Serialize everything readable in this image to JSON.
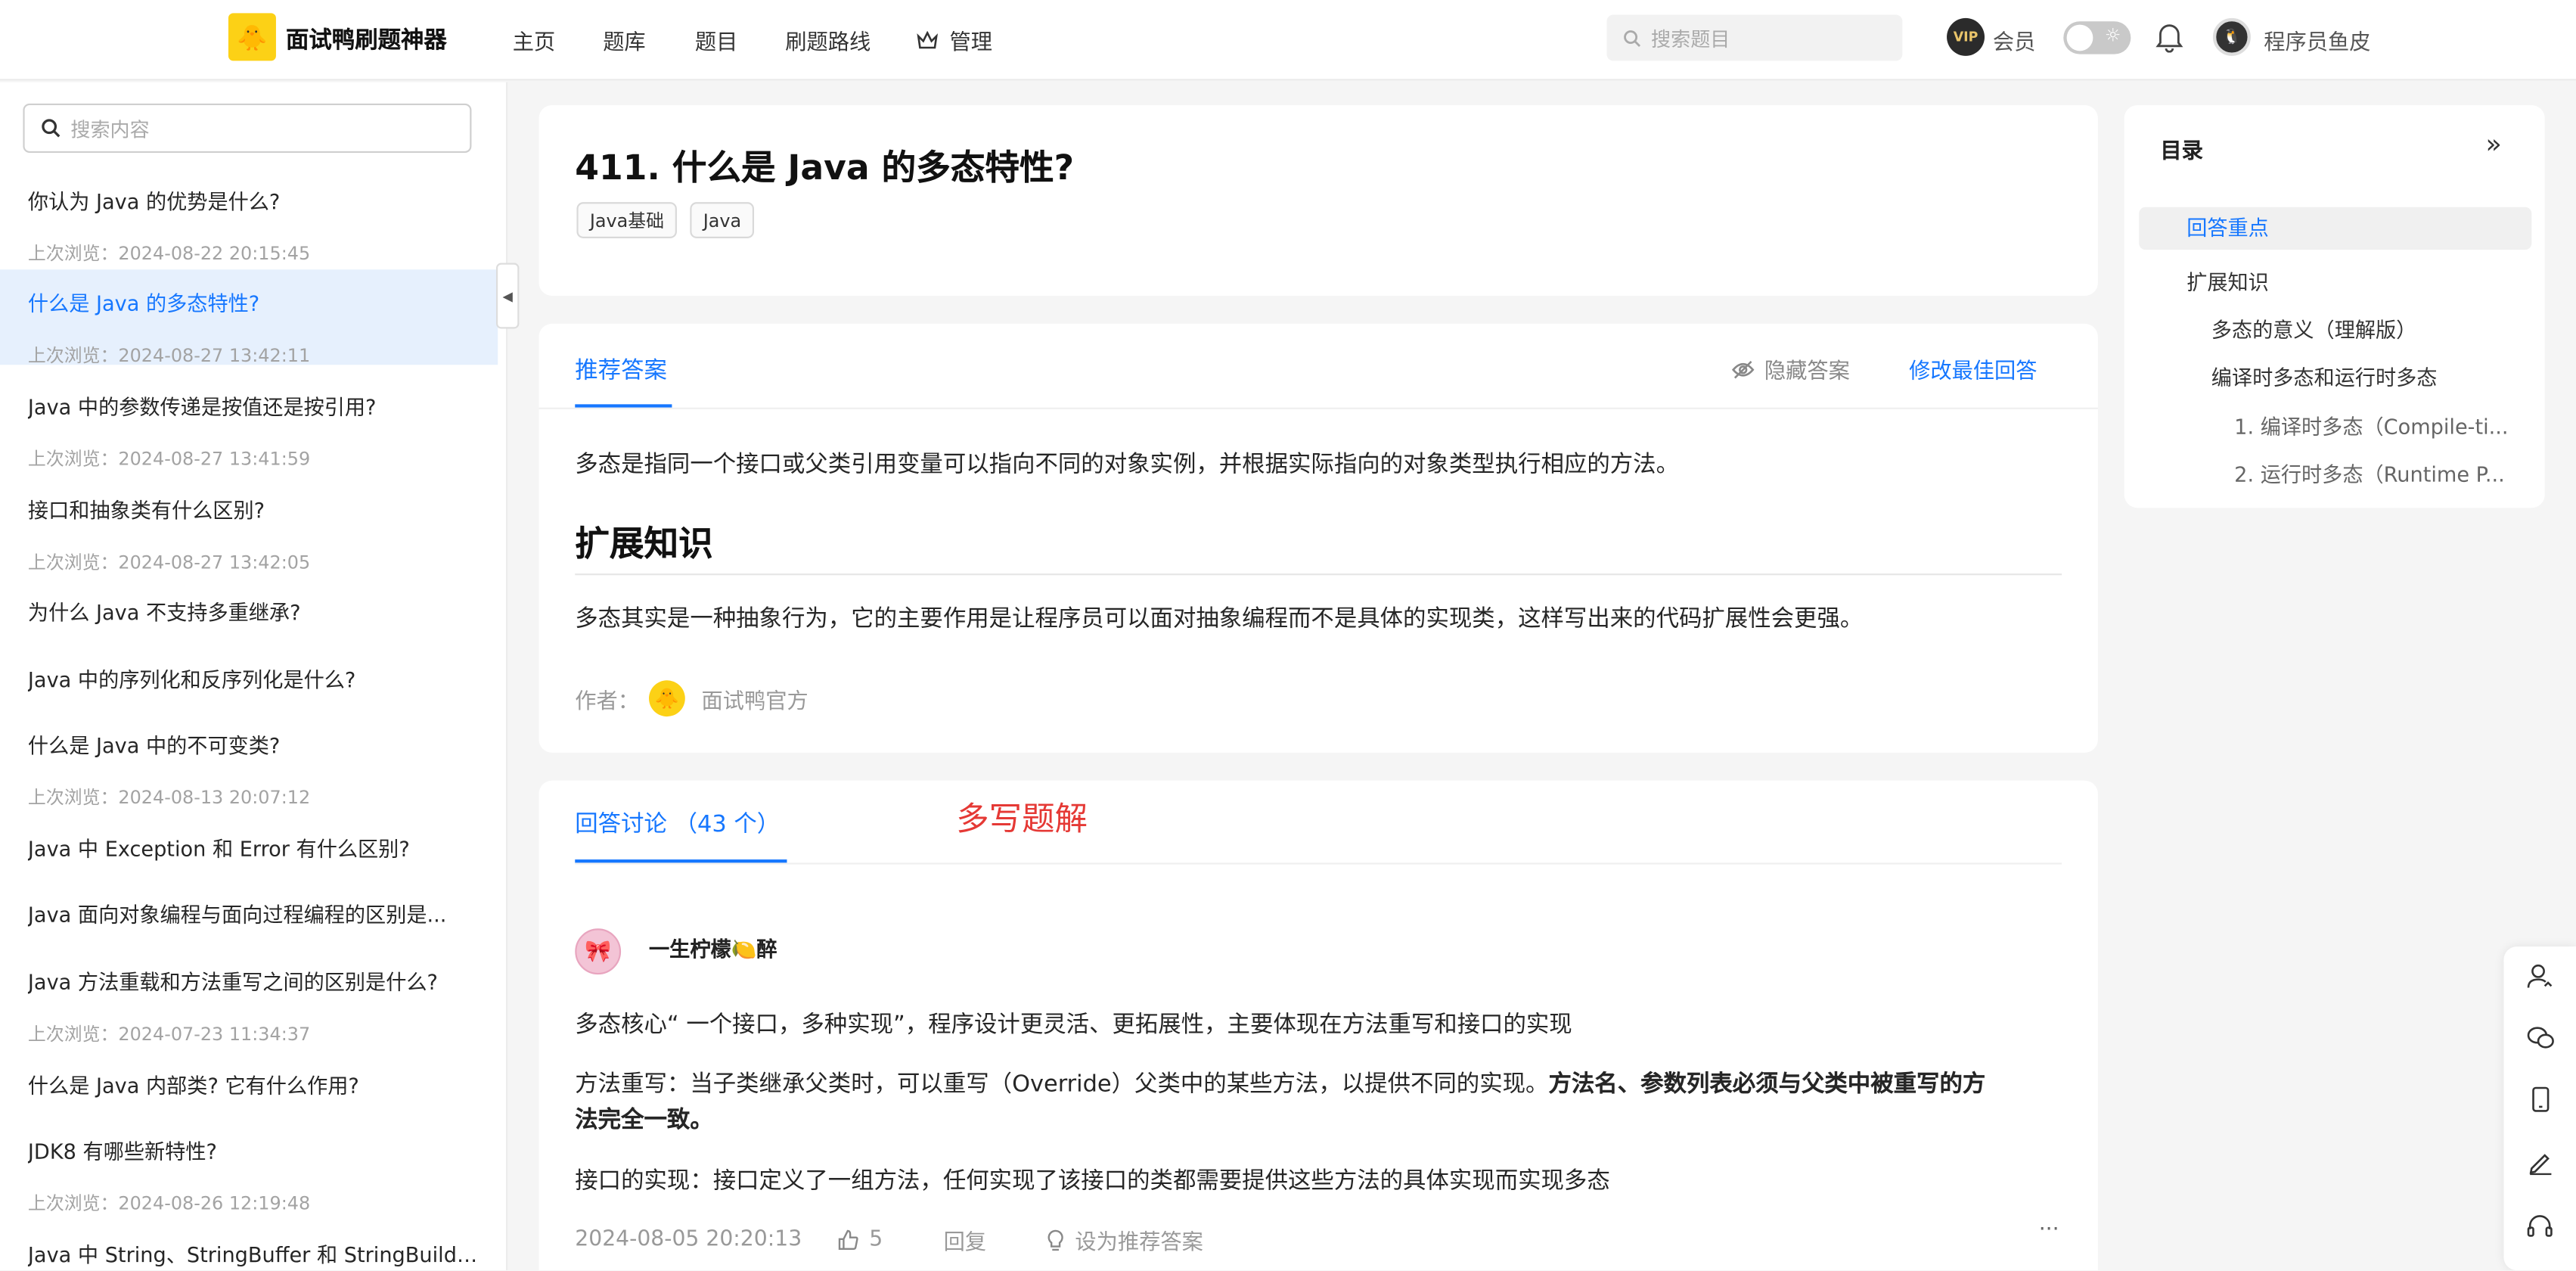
{
  "header": {
    "brand": "面试鸭刷题神器",
    "nav": [
      "主页",
      "题库",
      "题目",
      "刷题路线",
      "管理"
    ],
    "search_placeholder": "搜索题目",
    "vip_label": "会员",
    "vip_badge": "VIP",
    "username": "程序员鱼皮"
  },
  "sidebar": {
    "search_placeholder": "搜索内容",
    "items": [
      {
        "title": "你认为 Java 的优势是什么?",
        "date": "上次浏览：2024-08-22 20:15:45"
      },
      {
        "title": "什么是 Java 的多态特性?",
        "date": "上次浏览：2024-08-27 13:42:11"
      },
      {
        "title": "Java 中的参数传递是按值还是按引用?",
        "date": "上次浏览：2024-08-27 13:41:59"
      },
      {
        "title": "接口和抽象类有什么区别?",
        "date": "上次浏览：2024-08-27 13:42:05"
      },
      {
        "title": "为什么 Java 不支持多重继承?",
        "date": ""
      },
      {
        "title": "Java 中的序列化和反序列化是什么?",
        "date": ""
      },
      {
        "title": "什么是 Java 中的不可变类?",
        "date": "上次浏览：2024-08-13 20:07:12"
      },
      {
        "title": "Java 中 Exception 和 Error 有什么区别?",
        "date": ""
      },
      {
        "title": "Java 面向对象编程与面向过程编程的区别是...",
        "date": ""
      },
      {
        "title": "Java 方法重载和方法重写之间的区别是什么?",
        "date": "上次浏览：2024-07-23 11:34:37"
      },
      {
        "title": "什么是 Java 内部类? 它有什么作用?",
        "date": ""
      },
      {
        "title": "JDK8 有哪些新特性?",
        "date": "上次浏览：2024-08-26 12:19:48"
      },
      {
        "title": "Java 中 String、StringBuffer 和 StringBuilde...",
        "date": ""
      }
    ]
  },
  "question": {
    "title": "411. 什么是 Java 的多态特性?",
    "tags": [
      "Java基础",
      "Java"
    ]
  },
  "answer": {
    "tab": "推荐答案",
    "hide_label": "隐藏答案",
    "edit_label": "修改最佳回答",
    "summary": "多态是指同一个接口或父类引用变量可以指向不同的对象实例，并根据实际指向的对象类型执行相应的方法。",
    "heading": "扩展知识",
    "paragraph": "多态其实是一种抽象行为，它的主要作用是让程序员可以面对抽象编程而不是具体的实现类，这样写出来的代码扩展性会更强。",
    "author_label": "作者：",
    "author_name": "面试鸭官方"
  },
  "discussion": {
    "tab": "回答讨论 （43 个）",
    "annotation": "多写题解",
    "comment": {
      "user": "一生柠檬🍋醉",
      "p1": "多态核心“ 一个接口，多种实现”，程序设计更灵活、更拓展性，主要体现在方法重写和接口的实现",
      "p2_plain": "方法重写：当子类继承父类时，可以重写（Override）父类中的某些方法，以提供不同的实现。",
      "p2_bold_line1": "方法名、参数列表必须与父类中被重写的方",
      "p2_bold_line2": "法完全一致。",
      "p3": "接口的实现：接口定义了一组方法，任何实现了该接口的类都需要提供这些方法的具体实现而实现多态",
      "time": "2024-08-05 20:20:13",
      "likes": "5",
      "reply": "回复",
      "recommend": "设为推荐答案",
      "more": "···"
    }
  },
  "toc": {
    "title": "目录",
    "items": [
      "回答重点",
      "扩展知识",
      "多态的意义（理解版）",
      "编译时多态和运行时多态",
      "1. 编译时多态（Compile-ti...",
      "2. 运行时多态（Runtime P..."
    ]
  },
  "colors": {
    "accent": "#1677ff",
    "annotation": "#e53935",
    "brand": "#fcd116"
  }
}
